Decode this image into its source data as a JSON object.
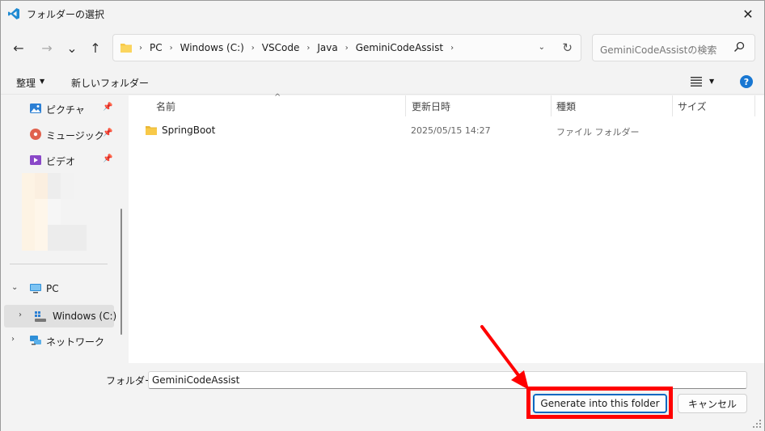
{
  "window": {
    "title": "フォルダーの選択",
    "close_glyph": "✕"
  },
  "nav": {
    "back_glyph": "←",
    "forward_glyph": "→",
    "recent_glyph": "⌄",
    "up_glyph": "↑",
    "breadcrumbs": [
      "PC",
      "Windows (C:)",
      "VSCode",
      "Java",
      "GeminiCodeAssist"
    ],
    "refresh_glyph": "↻",
    "search_placeholder": "GeminiCodeAssistの検索"
  },
  "toolbar": {
    "organize_label": "整理",
    "new_folder_label": "新しいフォルダー",
    "help_glyph": "?"
  },
  "sidebar": {
    "quick_access": [
      {
        "label": "ピクチャ",
        "icon": "pictures-icon"
      },
      {
        "label": "ミュージック",
        "icon": "music-icon"
      },
      {
        "label": "ビデオ",
        "icon": "videos-icon"
      }
    ],
    "pc_label": "PC",
    "drive_label": "Windows (C:)",
    "network_label": "ネットワーク"
  },
  "columns": {
    "name": "名前",
    "modified": "更新日時",
    "type": "種類",
    "size": "サイズ"
  },
  "files": [
    {
      "name": "SpringBoot",
      "modified": "2025/05/15 14:27",
      "type": "ファイル フォルダー",
      "size": ""
    }
  ],
  "footer": {
    "folder_label": "フォルダー:",
    "folder_value": "GeminiCodeAssist",
    "primary_button": "Generate into this folder",
    "cancel_button": "キャンセル"
  },
  "colors": {
    "accent": "#0067c0",
    "annotation": "#ff0000",
    "folder": "#f8c948"
  }
}
